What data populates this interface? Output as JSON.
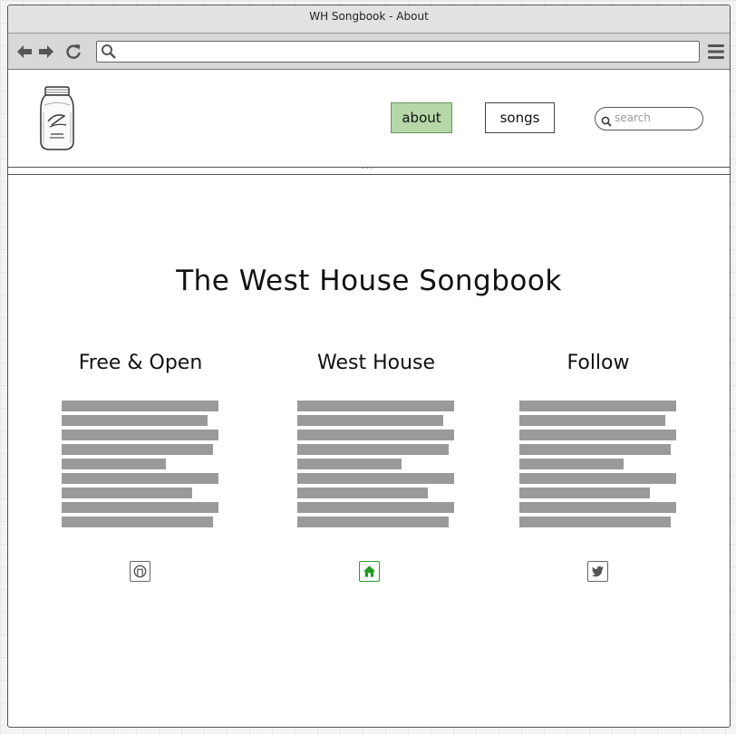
{
  "window": {
    "title": "WH Songbook - About"
  },
  "toolbar": {
    "back_icon": "back-arrow-icon",
    "forward_icon": "forward-arrow-icon",
    "reload_icon": "reload-icon",
    "url_value": "",
    "menu_icon": "hamburger-menu-icon"
  },
  "header": {
    "logo_icon": "mason-jar-logo",
    "nav": {
      "about_label": "about",
      "songs_label": "songs"
    },
    "search_placeholder": "search",
    "colors": {
      "active_nav": "#b6d7a8"
    }
  },
  "main": {
    "title": "The West House Songbook",
    "columns": [
      {
        "heading": "Free & Open",
        "icon": "github-icon"
      },
      {
        "heading": "West House",
        "icon": "home-icon"
      },
      {
        "heading": "Follow",
        "icon": "twitter-icon"
      }
    ]
  }
}
